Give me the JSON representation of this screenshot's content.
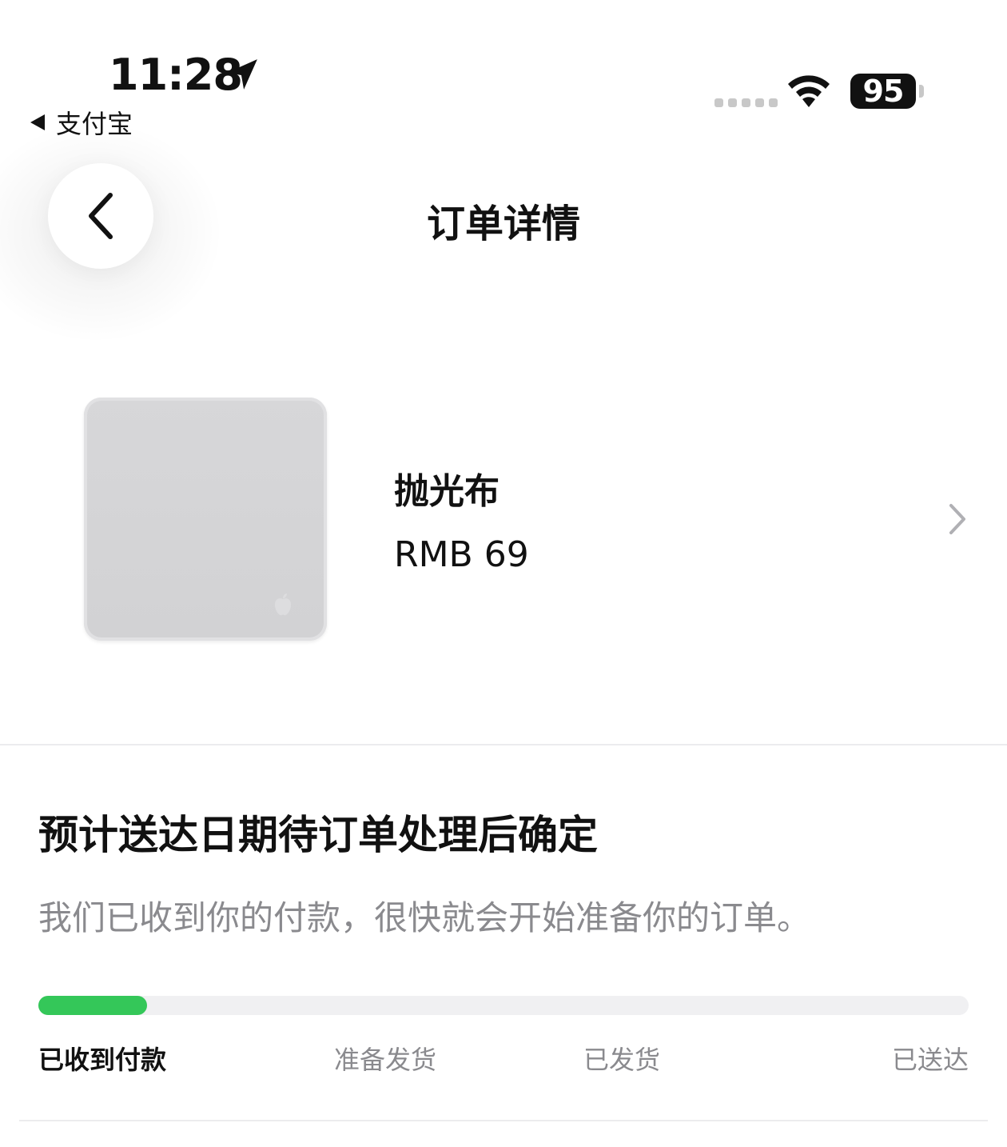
{
  "status_bar": {
    "time": "11:28",
    "back_app_label": "支付宝",
    "battery": "95"
  },
  "nav": {
    "title": "订单详情"
  },
  "product": {
    "name": "抛光布",
    "price": "RMB 69"
  },
  "delivery": {
    "title": "预计送达日期待订单处理后确定",
    "description": "我们已收到你的付款，很快就会开始准备你的订单。",
    "progress": 0.117,
    "progress_color": "#34c759",
    "steps": [
      {
        "label": "已收到付款",
        "done": true
      },
      {
        "label": "准备发货",
        "done": false
      },
      {
        "label": "已发货",
        "done": false
      },
      {
        "label": "已送达",
        "done": false
      }
    ]
  }
}
